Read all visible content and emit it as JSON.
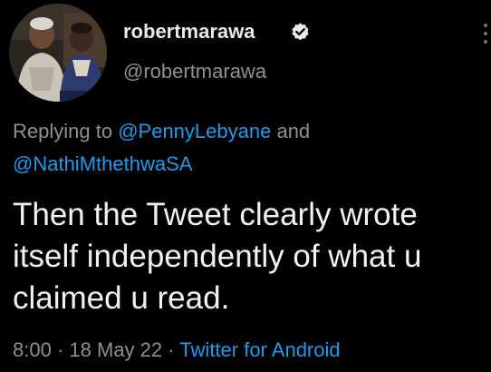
{
  "user": {
    "display_name": "robertmarawa",
    "handle": "@robertmarawa",
    "verified": true,
    "verified_icon": "verified-badge-icon"
  },
  "reply": {
    "prefix": "Replying to",
    "mention_1": "@PennyLebyane",
    "joiner": "and",
    "mention_2": "@NathiMthethwaSA"
  },
  "tweet": {
    "lines": [
      "Then the Tweet clearly wrote",
      "itself independently of what u",
      "claimed u read."
    ]
  },
  "meta": {
    "time": "8:00",
    "separator": "·",
    "date": "18 May 22",
    "source": "Twitter for Android"
  },
  "colors": {
    "background": "#000000",
    "text": "#e7e9ea",
    "secondary": "#8b9197",
    "link": "#1d9bf0"
  }
}
